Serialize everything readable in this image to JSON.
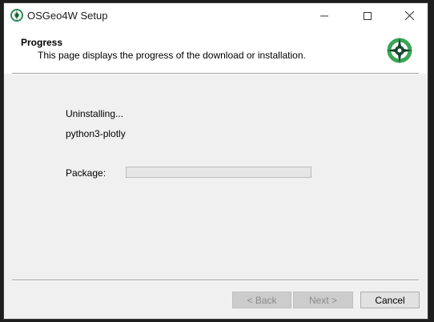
{
  "window": {
    "title": "OSGeo4W Setup"
  },
  "header": {
    "title": "Progress",
    "subtitle": "This page displays the progress of the download or installation."
  },
  "progress": {
    "action_text": "Uninstalling...",
    "item_text": "python3-plotly",
    "package_label": "Package:",
    "package_fraction": 0
  },
  "buttons": {
    "back_label": "< Back",
    "next_label": "Next >",
    "cancel_label": "Cancel"
  },
  "icons": {
    "title_icon": "osgeo-logo-icon",
    "header_logo": "osgeo-logo-icon",
    "minimize": "minimize-icon",
    "maximize": "maximize-icon",
    "close": "close-icon"
  }
}
